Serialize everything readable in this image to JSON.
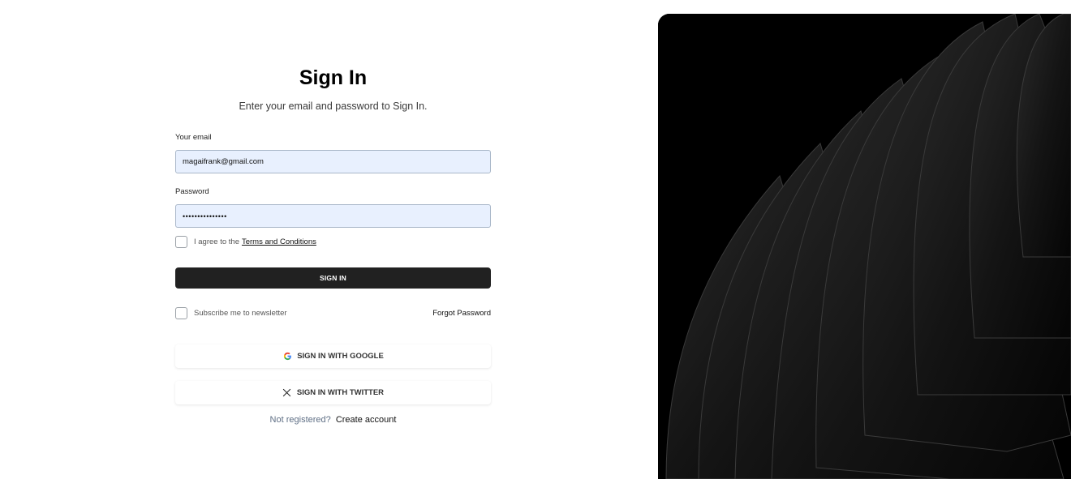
{
  "signin": {
    "title": "Sign In",
    "subtitle": "Enter your email and password to Sign In."
  },
  "form": {
    "email_label": "Your email",
    "email_value": "magaifrank@gmail.com",
    "password_label": "Password",
    "password_masked": "•••••••••••••••",
    "terms_text": "I agree to the",
    "terms_link": "Terms and Conditions",
    "terms_checked": false,
    "submit_label": "SIGN IN",
    "newsletter_text": "Subscribe me to newsletter",
    "newsletter_checked": false,
    "forgot_label": "Forgot Password"
  },
  "social": {
    "google_label": "SIGN IN WITH GOOGLE",
    "google_icon": "google-icon",
    "twitter_label": "SIGN IN WITH TWITTER",
    "twitter_icon": "x-twitter-icon"
  },
  "register": {
    "prompt": "Not registered?",
    "link": "Create account"
  },
  "colors": {
    "input_fill": "#e8f0fe",
    "primary_button": "#212121",
    "hero_background": "#000000"
  }
}
